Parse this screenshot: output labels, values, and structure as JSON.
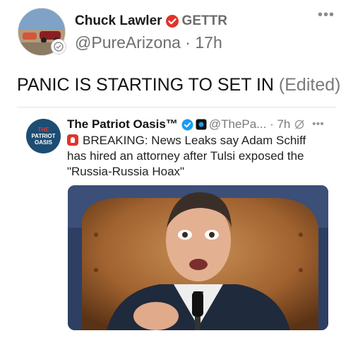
{
  "post": {
    "author_name": "Chuck Lawler",
    "platform": "GETTR",
    "handle": "@PureArizona",
    "separator": " · ",
    "age": "17h",
    "more_icon": "more-horizontal-icon",
    "headline": "PANIC IS STARTING TO SET IN",
    "edited_tag": "(Edited)"
  },
  "embedded_tweet": {
    "author_name": "The Patriot Oasis™",
    "handle": "@ThePa...",
    "separator": " · ",
    "age": "7h",
    "avatar_text_top": "THE",
    "avatar_text_mid": "PATRIOT",
    "avatar_text_bottom": "OASIS",
    "text": "BREAKING: News Leaks say Adam Schiff has hired an attorney after Tulsi exposed the \"Russia-Russia Hoax\"",
    "more_icon": "more-horizontal-icon",
    "image_alt": "man speaking at microphone in leather chair"
  },
  "colors": {
    "gettr_red": "#e0342b",
    "verified_blue": "#1d9bf0",
    "muted_text": "#6e6e6e"
  }
}
